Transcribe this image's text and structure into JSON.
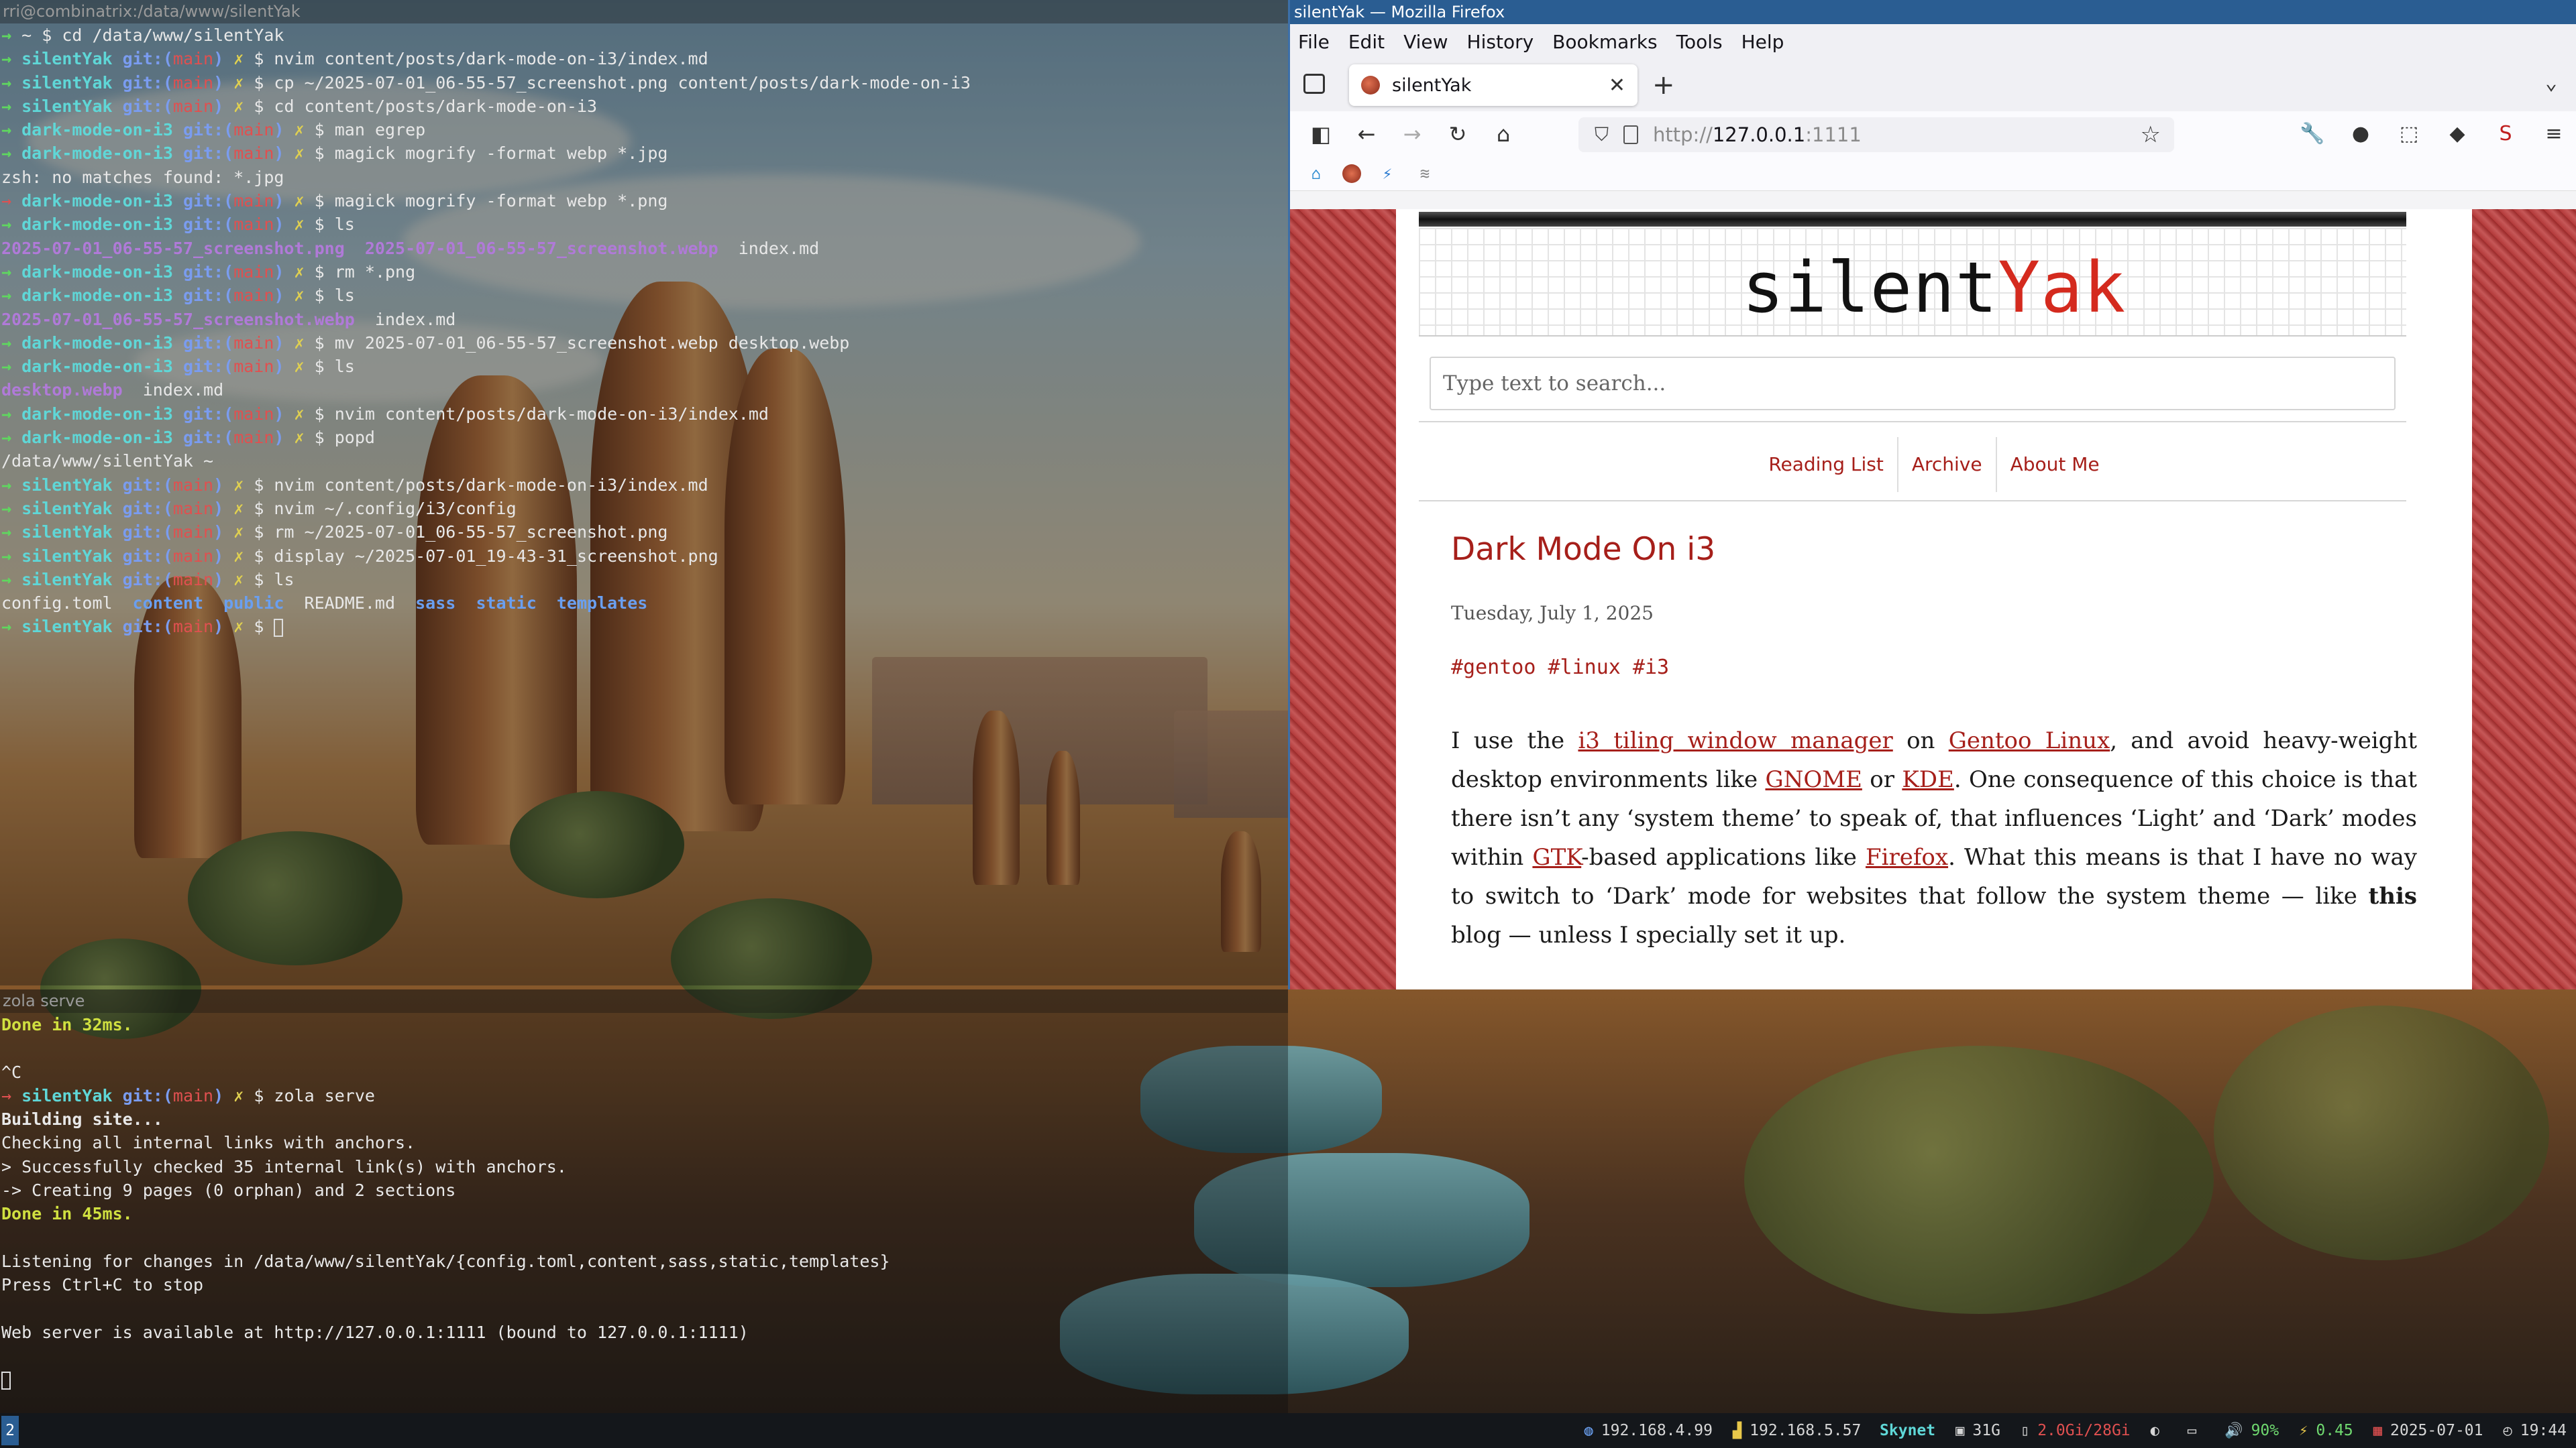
{
  "top_terminal": {
    "title": "rri@combinatrix:/data/www/silentYak",
    "lines": [
      [
        {
          "t": "→ ",
          "c": "c-green"
        },
        {
          "t": "~ $ cd /data/www/silentYak"
        }
      ],
      [
        {
          "t": "→ ",
          "c": "c-green"
        },
        {
          "t": "silentYak ",
          "c": "c-cyan"
        },
        {
          "t": "git:(",
          "c": "c-blue"
        },
        {
          "t": "main",
          "c": "c-red"
        },
        {
          "t": ") ",
          "c": "c-blue"
        },
        {
          "t": "✗ ",
          "c": "c-yellow"
        },
        {
          "t": "$ nvim content/posts/dark-mode-on-i3/index.md"
        }
      ],
      [
        {
          "t": "→ ",
          "c": "c-green"
        },
        {
          "t": "silentYak ",
          "c": "c-cyan"
        },
        {
          "t": "git:(",
          "c": "c-blue"
        },
        {
          "t": "main",
          "c": "c-red"
        },
        {
          "t": ") ",
          "c": "c-blue"
        },
        {
          "t": "✗ ",
          "c": "c-yellow"
        },
        {
          "t": "$ cp ~/2025-07-01_06-55-57_screenshot.png content/posts/dark-mode-on-i3"
        }
      ],
      [
        {
          "t": "→ ",
          "c": "c-green"
        },
        {
          "t": "silentYak ",
          "c": "c-cyan"
        },
        {
          "t": "git:(",
          "c": "c-blue"
        },
        {
          "t": "main",
          "c": "c-red"
        },
        {
          "t": ") ",
          "c": "c-blue"
        },
        {
          "t": "✗ ",
          "c": "c-yellow"
        },
        {
          "t": "$ cd content/posts/dark-mode-on-i3"
        }
      ],
      [
        {
          "t": "→ ",
          "c": "c-green"
        },
        {
          "t": "dark-mode-on-i3 ",
          "c": "c-cyan"
        },
        {
          "t": "git:(",
          "c": "c-blue"
        },
        {
          "t": "main",
          "c": "c-red"
        },
        {
          "t": ") ",
          "c": "c-blue"
        },
        {
          "t": "✗ ",
          "c": "c-yellow"
        },
        {
          "t": "$ man egrep"
        }
      ],
      [
        {
          "t": "→ ",
          "c": "c-green"
        },
        {
          "t": "dark-mode-on-i3 ",
          "c": "c-cyan"
        },
        {
          "t": "git:(",
          "c": "c-blue"
        },
        {
          "t": "main",
          "c": "c-red"
        },
        {
          "t": ") ",
          "c": "c-blue"
        },
        {
          "t": "✗ ",
          "c": "c-yellow"
        },
        {
          "t": "$ magick mogrify -format webp *.jpg"
        }
      ],
      [
        {
          "t": "zsh: no matches found: *.jpg"
        }
      ],
      [
        {
          "t": "→ ",
          "c": "c-red"
        },
        {
          "t": "dark-mode-on-i3 ",
          "c": "c-cyan"
        },
        {
          "t": "git:(",
          "c": "c-blue"
        },
        {
          "t": "main",
          "c": "c-red"
        },
        {
          "t": ") ",
          "c": "c-blue"
        },
        {
          "t": "✗ ",
          "c": "c-yellow"
        },
        {
          "t": "$ magick mogrify -format webp *.png"
        }
      ],
      [
        {
          "t": "→ ",
          "c": "c-green"
        },
        {
          "t": "dark-mode-on-i3 ",
          "c": "c-cyan"
        },
        {
          "t": "git:(",
          "c": "c-blue"
        },
        {
          "t": "main",
          "c": "c-red"
        },
        {
          "t": ") ",
          "c": "c-blue"
        },
        {
          "t": "✗ ",
          "c": "c-yellow"
        },
        {
          "t": "$ ls"
        }
      ],
      [
        {
          "t": "2025-07-01_06-55-57_screenshot.png",
          "c": "c-file-png"
        },
        {
          "t": "  "
        },
        {
          "t": "2025-07-01_06-55-57_screenshot.webp",
          "c": "c-file-webp"
        },
        {
          "t": "  index.md"
        }
      ],
      [
        {
          "t": "→ ",
          "c": "c-green"
        },
        {
          "t": "dark-mode-on-i3 ",
          "c": "c-cyan"
        },
        {
          "t": "git:(",
          "c": "c-blue"
        },
        {
          "t": "main",
          "c": "c-red"
        },
        {
          "t": ") ",
          "c": "c-blue"
        },
        {
          "t": "✗ ",
          "c": "c-yellow"
        },
        {
          "t": "$ rm *.png"
        }
      ],
      [
        {
          "t": "→ ",
          "c": "c-green"
        },
        {
          "t": "dark-mode-on-i3 ",
          "c": "c-cyan"
        },
        {
          "t": "git:(",
          "c": "c-blue"
        },
        {
          "t": "main",
          "c": "c-red"
        },
        {
          "t": ") ",
          "c": "c-blue"
        },
        {
          "t": "✗ ",
          "c": "c-yellow"
        },
        {
          "t": "$ ls"
        }
      ],
      [
        {
          "t": "2025-07-01_06-55-57_screenshot.webp",
          "c": "c-file-webp"
        },
        {
          "t": "  index.md"
        }
      ],
      [
        {
          "t": "→ ",
          "c": "c-green"
        },
        {
          "t": "dark-mode-on-i3 ",
          "c": "c-cyan"
        },
        {
          "t": "git:(",
          "c": "c-blue"
        },
        {
          "t": "main",
          "c": "c-red"
        },
        {
          "t": ") ",
          "c": "c-blue"
        },
        {
          "t": "✗ ",
          "c": "c-yellow"
        },
        {
          "t": "$ mv 2025-07-01_06-55-57_screenshot.webp desktop.webp"
        }
      ],
      [
        {
          "t": "→ ",
          "c": "c-green"
        },
        {
          "t": "dark-mode-on-i3 ",
          "c": "c-cyan"
        },
        {
          "t": "git:(",
          "c": "c-blue"
        },
        {
          "t": "main",
          "c": "c-red"
        },
        {
          "t": ") ",
          "c": "c-blue"
        },
        {
          "t": "✗ ",
          "c": "c-yellow"
        },
        {
          "t": "$ ls"
        }
      ],
      [
        {
          "t": "desktop.webp",
          "c": "c-file-webp"
        },
        {
          "t": "  index.md"
        }
      ],
      [
        {
          "t": "→ ",
          "c": "c-green"
        },
        {
          "t": "dark-mode-on-i3 ",
          "c": "c-cyan"
        },
        {
          "t": "git:(",
          "c": "c-blue"
        },
        {
          "t": "main",
          "c": "c-red"
        },
        {
          "t": ") ",
          "c": "c-blue"
        },
        {
          "t": "✗ ",
          "c": "c-yellow"
        },
        {
          "t": "$ nvim content/posts/dark-mode-on-i3/index.md"
        }
      ],
      [
        {
          "t": "→ ",
          "c": "c-green"
        },
        {
          "t": "dark-mode-on-i3 ",
          "c": "c-cyan"
        },
        {
          "t": "git:(",
          "c": "c-blue"
        },
        {
          "t": "main",
          "c": "c-red"
        },
        {
          "t": ") ",
          "c": "c-blue"
        },
        {
          "t": "✗ ",
          "c": "c-yellow"
        },
        {
          "t": "$ popd"
        }
      ],
      [
        {
          "t": "/data/www/silentYak ~"
        }
      ],
      [
        {
          "t": "→ ",
          "c": "c-green"
        },
        {
          "t": "silentYak ",
          "c": "c-cyan"
        },
        {
          "t": "git:(",
          "c": "c-blue"
        },
        {
          "t": "main",
          "c": "c-red"
        },
        {
          "t": ") ",
          "c": "c-blue"
        },
        {
          "t": "✗ ",
          "c": "c-yellow"
        },
        {
          "t": "$ nvim content/posts/dark-mode-on-i3/index.md"
        }
      ],
      [
        {
          "t": "→ ",
          "c": "c-green"
        },
        {
          "t": "silentYak ",
          "c": "c-cyan"
        },
        {
          "t": "git:(",
          "c": "c-blue"
        },
        {
          "t": "main",
          "c": "c-red"
        },
        {
          "t": ") ",
          "c": "c-blue"
        },
        {
          "t": "✗ ",
          "c": "c-yellow"
        },
        {
          "t": "$ nvim ~/.config/i3/config"
        }
      ],
      [
        {
          "t": "→ ",
          "c": "c-green"
        },
        {
          "t": "silentYak ",
          "c": "c-cyan"
        },
        {
          "t": "git:(",
          "c": "c-blue"
        },
        {
          "t": "main",
          "c": "c-red"
        },
        {
          "t": ") ",
          "c": "c-blue"
        },
        {
          "t": "✗ ",
          "c": "c-yellow"
        },
        {
          "t": "$ rm ~/2025-07-01_06-55-57_screenshot.png"
        }
      ],
      [
        {
          "t": "→ ",
          "c": "c-green"
        },
        {
          "t": "silentYak ",
          "c": "c-cyan"
        },
        {
          "t": "git:(",
          "c": "c-blue"
        },
        {
          "t": "main",
          "c": "c-red"
        },
        {
          "t": ") ",
          "c": "c-blue"
        },
        {
          "t": "✗ ",
          "c": "c-yellow"
        },
        {
          "t": "$ display ~/2025-07-01_19-43-31_screenshot.png"
        }
      ],
      [
        {
          "t": "→ ",
          "c": "c-green"
        },
        {
          "t": "silentYak ",
          "c": "c-cyan"
        },
        {
          "t": "git:(",
          "c": "c-blue"
        },
        {
          "t": "main",
          "c": "c-red"
        },
        {
          "t": ") ",
          "c": "c-blue"
        },
        {
          "t": "✗ ",
          "c": "c-yellow"
        },
        {
          "t": "$ ls"
        }
      ],
      [
        {
          "t": "config.toml  "
        },
        {
          "t": "content",
          "c": "c-dir"
        },
        {
          "t": "  "
        },
        {
          "t": "public",
          "c": "c-dir"
        },
        {
          "t": "  README.md  "
        },
        {
          "t": "sass",
          "c": "c-dir"
        },
        {
          "t": "  "
        },
        {
          "t": "static",
          "c": "c-dir"
        },
        {
          "t": "  "
        },
        {
          "t": "templates",
          "c": "c-dir"
        }
      ],
      [
        {
          "t": "→ ",
          "c": "c-green"
        },
        {
          "t": "silentYak ",
          "c": "c-cyan"
        },
        {
          "t": "git:(",
          "c": "c-blue"
        },
        {
          "t": "main",
          "c": "c-red"
        },
        {
          "t": ") ",
          "c": "c-blue"
        },
        {
          "t": "✗ ",
          "c": "c-yellow"
        },
        {
          "t": "$ "
        },
        {
          "cursor": true
        }
      ]
    ]
  },
  "bottom_terminal": {
    "title": "zola serve",
    "lines": [
      [
        {
          "t": "Done in 32ms.",
          "c": "c-done"
        }
      ],
      [
        {
          "t": ""
        }
      ],
      [
        {
          "t": "^C"
        }
      ],
      [
        {
          "t": "→ ",
          "c": "c-red"
        },
        {
          "t": "silentYak ",
          "c": "c-cyan"
        },
        {
          "t": "git:(",
          "c": "c-blue"
        },
        {
          "t": "main",
          "c": "c-red"
        },
        {
          "t": ") ",
          "c": "c-blue"
        },
        {
          "t": "✗ ",
          "c": "c-yellow"
        },
        {
          "t": "$ zola serve"
        }
      ],
      [
        {
          "t": "Building site...",
          "c": "c-bold"
        }
      ],
      [
        {
          "t": "Checking all internal links with anchors."
        }
      ],
      [
        {
          "t": "> Successfully checked 35 internal link(s) with anchors."
        }
      ],
      [
        {
          "t": "-> Creating 9 pages (0 orphan) and 2 sections"
        }
      ],
      [
        {
          "t": "Done in 45ms.",
          "c": "c-done"
        }
      ],
      [
        {
          "t": ""
        }
      ],
      [
        {
          "t": "Listening for changes in /data/www/silentYak/{config.toml,content,sass,static,templates}"
        }
      ],
      [
        {
          "t": "Press Ctrl+C to stop"
        }
      ],
      [
        {
          "t": ""
        }
      ],
      [
        {
          "t": "Web server is available at http://127.0.0.1:1111 (bound to 127.0.0.1:1111)"
        }
      ],
      [
        {
          "t": ""
        }
      ],
      [
        {
          "cursor": true
        }
      ]
    ]
  },
  "firefox": {
    "window_title": "silentYak — Mozilla Firefox",
    "menu": [
      "File",
      "Edit",
      "View",
      "History",
      "Bookmarks",
      "Tools",
      "Help"
    ],
    "tab_title": "silentYak",
    "new_tab": "+",
    "url_prefix": "http://",
    "url_host": "127.0.0.1",
    "url_suffix": ":1111"
  },
  "page": {
    "site_title_a": "silent",
    "site_title_b": "Yak",
    "search_placeholder": "Type text to search...",
    "nav": [
      "Reading List",
      "Archive",
      "About Me"
    ],
    "post_title": "Dark Mode On i3",
    "post_date": "Tuesday, July 1, 2025",
    "post_tags": "#gentoo #linux #i3",
    "body": {
      "p1": "I use the ",
      "l1": "i3 tiling window manager",
      "p2": " on ",
      "l2": "Gentoo Linux",
      "p3": ", and avoid heavy-weight desktop environments like ",
      "l3": "GNOME",
      "p4": " or ",
      "l4": "KDE",
      "p5": ". One consequence of this choice is that there isn’t any ‘system theme’ to speak of, that influences ‘Light’ and ‘Dark’ modes within ",
      "l5": "GTK",
      "p6": "-based applications like ",
      "l6": "Firefox",
      "p7": ". What this means is that I have no way to switch to ‘Dark’ mode for websites that follow the system theme — like ",
      "b1": "this",
      "p8": " blog — unless I specially set it up."
    }
  },
  "statusbar": {
    "workspace": "2",
    "ip_eth": "192.168.4.99",
    "ip_wifi": "192.168.5.57",
    "ssid": "Skynet",
    "disk": "31G",
    "mem": "2.0Gi/28Gi",
    "volume": "90%",
    "load": "0.45",
    "date": "2025-07-01",
    "time": "19:44"
  }
}
